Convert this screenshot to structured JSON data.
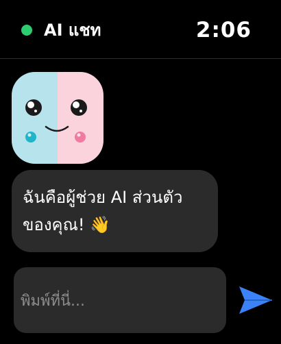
{
  "header": {
    "title": "AI แชท",
    "status_icon": "online-status-dot",
    "status_color": "#2ecc71",
    "time": "2:06"
  },
  "messages": [
    {
      "sender": "assistant",
      "avatar_icon": "smiling-face-avatar",
      "lines": [
        "ฉันคือผู้ช่วย AI ส่วนตัว",
        "ของคุณ! 👋"
      ]
    }
  ],
  "composer": {
    "placeholder": "พิมพ์ที่นี่...",
    "value": "",
    "send_icon": "send-arrow-icon",
    "send_color": "#3b82f6"
  },
  "colors": {
    "background": "#000000",
    "bubble": "#2b2b2b",
    "avatar_left": "#b7e4ec",
    "avatar_right": "#fbd3dc"
  }
}
